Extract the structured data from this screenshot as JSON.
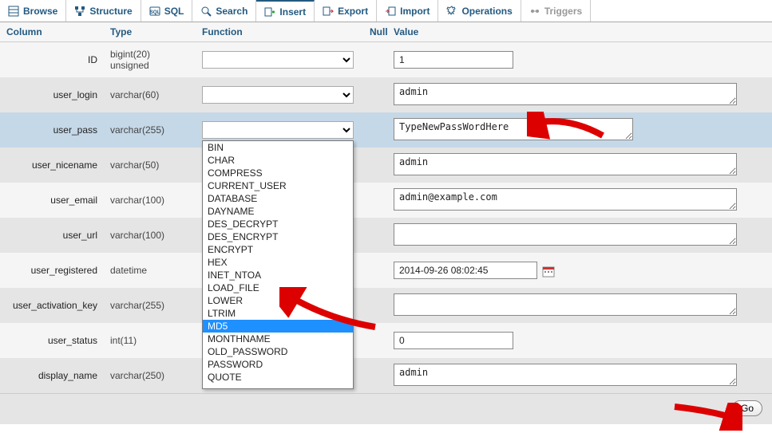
{
  "tabs": [
    {
      "label": "Browse",
      "icon": "table-icon"
    },
    {
      "label": "Structure",
      "icon": "structure-icon"
    },
    {
      "label": "SQL",
      "icon": "sql-icon"
    },
    {
      "label": "Search",
      "icon": "search-icon"
    },
    {
      "label": "Insert",
      "icon": "insert-icon",
      "active": true
    },
    {
      "label": "Export",
      "icon": "export-icon"
    },
    {
      "label": "Import",
      "icon": "import-icon"
    },
    {
      "label": "Operations",
      "icon": "operations-icon"
    },
    {
      "label": "Triggers",
      "icon": "triggers-icon",
      "disabled": true
    }
  ],
  "headers": {
    "column": "Column",
    "type": "Type",
    "function": "Function",
    "null": "Null",
    "value": "Value"
  },
  "rows": [
    {
      "col": "ID",
      "type": "bigint(20) unsigned",
      "value": "1",
      "kind": "input-short"
    },
    {
      "col": "user_login",
      "type": "varchar(60)",
      "value": "admin",
      "kind": "textarea"
    },
    {
      "col": "user_pass",
      "type": "varchar(255)",
      "value": "TypeNewPassWordHere",
      "kind": "textarea-pw",
      "highlight": true,
      "dropdown_open": true
    },
    {
      "col": "user_nicename",
      "type": "varchar(50)",
      "value": "admin",
      "kind": "textarea"
    },
    {
      "col": "user_email",
      "type": "varchar(100)",
      "value": "admin@example.com",
      "kind": "textarea"
    },
    {
      "col": "user_url",
      "type": "varchar(100)",
      "value": "",
      "kind": "textarea"
    },
    {
      "col": "user_registered",
      "type": "datetime",
      "value": "2014-09-26 08:02:45",
      "kind": "input-mid",
      "calendar": true
    },
    {
      "col": "user_activation_key",
      "type": "varchar(255)",
      "value": "",
      "kind": "textarea"
    },
    {
      "col": "user_status",
      "type": "int(11)",
      "value": "0",
      "kind": "input-short"
    },
    {
      "col": "display_name",
      "type": "varchar(250)",
      "value": "admin",
      "kind": "textarea"
    }
  ],
  "dropdown": {
    "options": [
      "BIN",
      "CHAR",
      "COMPRESS",
      "CURRENT_USER",
      "DATABASE",
      "DAYNAME",
      "DES_DECRYPT",
      "DES_ENCRYPT",
      "ENCRYPT",
      "HEX",
      "INET_NTOA",
      "LOAD_FILE",
      "LOWER",
      "LTRIM",
      "MD5",
      "MONTHNAME",
      "OLD_PASSWORD",
      "PASSWORD",
      "QUOTE"
    ],
    "selected": "MD5"
  },
  "footer": {
    "go_label": "Go"
  }
}
